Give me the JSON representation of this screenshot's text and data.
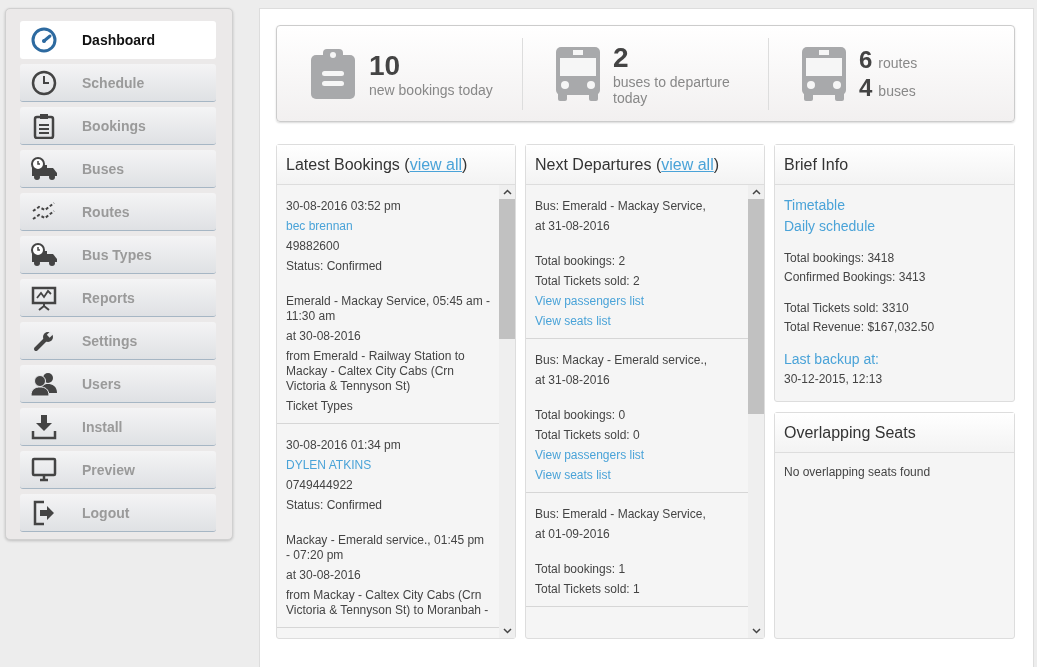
{
  "sidebar": {
    "items": [
      {
        "label": "Dashboard",
        "selected": true
      },
      {
        "label": "Schedule",
        "selected": false
      },
      {
        "label": "Bookings",
        "selected": false
      },
      {
        "label": "Buses",
        "selected": false
      },
      {
        "label": "Routes",
        "selected": false
      },
      {
        "label": "Bus Types",
        "selected": false
      },
      {
        "label": "Reports",
        "selected": false
      },
      {
        "label": "Settings",
        "selected": false
      },
      {
        "label": "Users",
        "selected": false
      },
      {
        "label": "Install",
        "selected": false
      },
      {
        "label": "Preview",
        "selected": false
      },
      {
        "label": "Logout",
        "selected": false
      }
    ]
  },
  "stats": [
    {
      "kind": "single",
      "lines": [
        {
          "number": "10",
          "label": "new bookings today"
        }
      ]
    },
    {
      "kind": "single",
      "lines": [
        {
          "number": "2",
          "label": "buses to departure today"
        }
      ]
    },
    {
      "kind": "double",
      "lines": [
        {
          "number": "6",
          "label": "routes"
        },
        {
          "number": "4",
          "label": "buses"
        }
      ]
    }
  ],
  "panels": [
    {
      "title": "Latest Bookings (",
      "link": "view all",
      "title_end": ")",
      "entries": [
        {
          "blocks": [
            [
              {
                "kind": "text",
                "text": "30-08-2016 03:52 pm"
              },
              {
                "kind": "link",
                "text": "bec brennan"
              },
              {
                "kind": "text",
                "text": "49882600"
              },
              {
                "kind": "text",
                "text": "Status: Confirmed"
              }
            ],
            [
              {
                "kind": "text",
                "text": "Emerald - Mackay Service, 05:45 am - 11:30 am"
              },
              {
                "kind": "text",
                "text": "at 30-08-2016"
              },
              {
                "kind": "text",
                "text": "from Emerald - Railway Station to Mackay - Caltex City Cabs (Crn Victoria & Tennyson St)"
              },
              {
                "kind": "text",
                "text": "Ticket Types"
              }
            ]
          ]
        },
        {
          "blocks": [
            [
              {
                "kind": "text",
                "text": "30-08-2016 01:34 pm"
              },
              {
                "kind": "link",
                "text": "DYLEN ATKINS"
              },
              {
                "kind": "text",
                "text": "0749444922"
              },
              {
                "kind": "text",
                "text": "Status: Confirmed"
              }
            ],
            [
              {
                "kind": "text",
                "text": "Mackay - Emerald service., 01:45 pm - 07:20 pm"
              },
              {
                "kind": "text",
                "text": "at 30-08-2016"
              },
              {
                "kind": "text",
                "text": "from Mackay - Caltex City Cabs (Crn Victoria & Tennyson St) to Moranbah -"
              }
            ]
          ]
        }
      ]
    },
    {
      "title": "Next Departures (",
      "link": "view all",
      "title_end": ")",
      "entries": [
        {
          "blocks": [
            [
              {
                "kind": "text",
                "text": "Bus: Emerald - Mackay Service,"
              },
              {
                "kind": "text",
                "text": "at 31-08-2016"
              }
            ],
            [
              {
                "kind": "text",
                "text": "Total bookings: 2"
              },
              {
                "kind": "text",
                "text": "Total Tickets sold: 2"
              },
              {
                "kind": "link",
                "text": "View passengers list"
              },
              {
                "kind": "link",
                "text": "View seats list"
              }
            ]
          ]
        },
        {
          "blocks": [
            [
              {
                "kind": "text",
                "text": "Bus: Mackay - Emerald service.,"
              },
              {
                "kind": "text",
                "text": "at 31-08-2016"
              }
            ],
            [
              {
                "kind": "text",
                "text": "Total bookings: 0"
              },
              {
                "kind": "text",
                "text": "Total Tickets sold: 0"
              },
              {
                "kind": "link",
                "text": "View passengers list"
              },
              {
                "kind": "link",
                "text": "View seats list"
              }
            ]
          ]
        },
        {
          "blocks": [
            [
              {
                "kind": "text",
                "text": "Bus: Emerald - Mackay Service,"
              },
              {
                "kind": "text",
                "text": "at 01-09-2016"
              }
            ],
            [
              {
                "kind": "text",
                "text": "Total bookings: 1"
              },
              {
                "kind": "text",
                "text": "Total Tickets sold: 1"
              }
            ]
          ]
        }
      ]
    }
  ],
  "brief_info": {
    "title": "Brief Info",
    "blocks": [
      [
        {
          "kind": "biglink",
          "text": "Timetable"
        },
        {
          "kind": "biglink",
          "text": "Daily schedule"
        }
      ],
      [
        {
          "kind": "text",
          "text": "Total bookings: 3418"
        },
        {
          "kind": "text",
          "text": "Confirmed Bookings: 3413"
        }
      ],
      [
        {
          "kind": "text",
          "text": "Total Tickets sold: 3310"
        },
        {
          "kind": "text",
          "text": "Total Revenue: $167,032.50"
        }
      ],
      [
        {
          "kind": "biglink",
          "text": "Last backup at:"
        },
        {
          "kind": "text",
          "text": "30-12-2015, 12:13"
        }
      ]
    ]
  },
  "overlapping_seats": {
    "title": "Overlapping Seats",
    "message": "No overlapping seats found"
  }
}
